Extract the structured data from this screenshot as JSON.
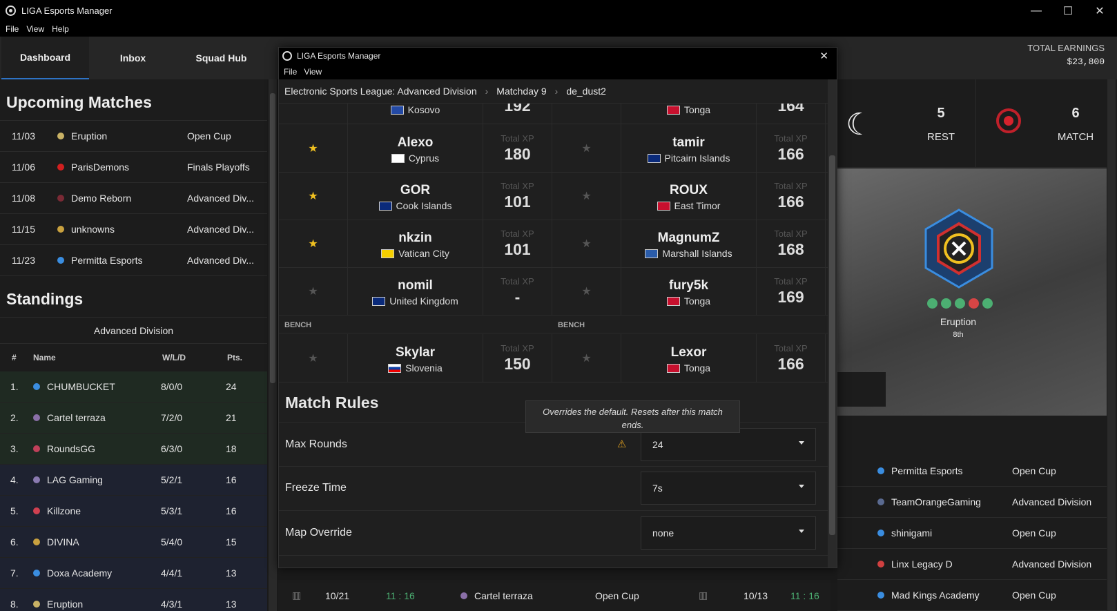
{
  "app": {
    "title": "LIGA Esports Manager",
    "menu": [
      "File",
      "View",
      "Help"
    ]
  },
  "window_controls": {
    "minimize": "—",
    "maximize": "☐",
    "close": "✕"
  },
  "tabs": [
    "Dashboard",
    "Inbox",
    "Squad Hub"
  ],
  "earnings": {
    "label": "TOTAL EARNINGS",
    "value": "$23,800"
  },
  "upcoming": {
    "title": "Upcoming Matches",
    "rows": [
      {
        "date": "11/03",
        "team": "Eruption",
        "comp": "Open Cup",
        "color": "#c9b265"
      },
      {
        "date": "11/06",
        "team": "ParisDemons",
        "comp": "Finals Playoffs",
        "color": "#d11f1f"
      },
      {
        "date": "11/08",
        "team": "Demo Reborn",
        "comp": "Advanced Div...",
        "color": "#7a2a35"
      },
      {
        "date": "11/15",
        "team": "unknowns",
        "comp": "Advanced Div...",
        "color": "#c9a13f"
      },
      {
        "date": "11/23",
        "team": "Permitta Esports",
        "comp": "Advanced Div...",
        "color": "#3a8de0"
      }
    ]
  },
  "standings": {
    "title": "Standings",
    "division": "Advanced Division",
    "headers": [
      "#",
      "Name",
      "W/L/D",
      "Pts."
    ],
    "rows": [
      {
        "pos": "1.",
        "name": "CHUMBUCKET",
        "wld": "8/0/0",
        "pts": "24",
        "color": "#3b8de0"
      },
      {
        "pos": "2.",
        "name": "Cartel terraza",
        "wld": "7/2/0",
        "pts": "21",
        "color": "#8a6fa8"
      },
      {
        "pos": "3.",
        "name": "RoundsGG",
        "wld": "6/3/0",
        "pts": "18",
        "color": "#c0405a"
      },
      {
        "pos": "4.",
        "name": "LAG Gaming",
        "wld": "5/2/1",
        "pts": "16",
        "color": "#8a7ab0"
      },
      {
        "pos": "5.",
        "name": "Killzone",
        "wld": "5/3/1",
        "pts": "16",
        "color": "#d04050"
      },
      {
        "pos": "6.",
        "name": "DIVINA",
        "wld": "5/4/0",
        "pts": "15",
        "color": "#c9a13f"
      },
      {
        "pos": "7.",
        "name": "Doxa Academy",
        "wld": "4/4/1",
        "pts": "13",
        "color": "#3a8de0"
      },
      {
        "pos": "8.",
        "name": "Eruption",
        "wld": "4/3/1",
        "pts": "13",
        "color": "#c9b265"
      }
    ]
  },
  "modal": {
    "title": "LIGA Esports Manager",
    "menu": [
      "File",
      "View"
    ],
    "breadcrumb": [
      "Electronic Sports League: Advanced Division",
      "Matchday 9",
      "de_dust2"
    ],
    "xp_label": "Total XP",
    "bench_label": "BENCH",
    "top_partial": {
      "left": {
        "nat": "Kosovo",
        "xp": "192"
      },
      "right": {
        "nat": "Tonga",
        "xp": "164"
      }
    },
    "players": [
      {
        "l": {
          "name": "Alexo",
          "nat": "Cyprus",
          "xp": "180",
          "star": true
        },
        "r": {
          "name": "tamir",
          "nat": "Pitcairn Islands",
          "xp": "166",
          "star": false
        }
      },
      {
        "l": {
          "name": "GOR",
          "nat": "Cook Islands",
          "xp": "101",
          "star": true
        },
        "r": {
          "name": "ROUX",
          "nat": "East Timor",
          "xp": "166",
          "star": false
        }
      },
      {
        "l": {
          "name": "nkzin",
          "nat": "Vatican City",
          "xp": "101",
          "star": true
        },
        "r": {
          "name": "MagnumZ",
          "nat": "Marshall Islands",
          "xp": "168",
          "star": false
        }
      },
      {
        "l": {
          "name": "nomil",
          "nat": "United Kingdom",
          "xp": "-",
          "star": false
        },
        "r": {
          "name": "fury5k",
          "nat": "Tonga",
          "xp": "169",
          "star": false
        }
      }
    ],
    "bench": {
      "l": {
        "name": "Skylar",
        "nat": "Slovenia",
        "xp": "150"
      },
      "r": {
        "name": "Lexor",
        "nat": "Tonga",
        "xp": "166"
      }
    },
    "rules_title": "Match Rules",
    "tooltip": "Overrides the default. Resets after this match ends.",
    "rules": [
      {
        "label": "Max Rounds",
        "value": "24"
      },
      {
        "label": "Freeze Time",
        "value": "7s"
      },
      {
        "label": "Map Override",
        "value": "none"
      }
    ]
  },
  "right": {
    "rest": {
      "value": "5",
      "label": "REST"
    },
    "match": {
      "value": "6",
      "label": "MATCH"
    },
    "opponent": {
      "name": "Eruption",
      "rank": "8th",
      "form": [
        "#4caf72",
        "#4caf72",
        "#4caf72",
        "#d64545",
        "#4caf72"
      ]
    },
    "list": [
      {
        "team": "Permitta Esports",
        "comp": "Open Cup",
        "color": "#3a8de0"
      },
      {
        "team": "TeamOrangeGaming",
        "comp": "Advanced Division",
        "color": "#5a6a90"
      },
      {
        "team": "shinigami",
        "comp": "Open Cup",
        "color": "#3a8de0"
      },
      {
        "team": "Linx Legacy D",
        "comp": "Advanced Division",
        "color": "#d04040"
      },
      {
        "team": "Mad Kings Academy",
        "comp": "Open Cup",
        "color": "#3a8de0"
      }
    ]
  },
  "bottom": {
    "left": {
      "date": "10/21",
      "score": "11 : 16",
      "team": "Cartel terraza",
      "comp": "Open Cup"
    },
    "right": {
      "date": "10/13",
      "score": "11 : 16"
    }
  }
}
